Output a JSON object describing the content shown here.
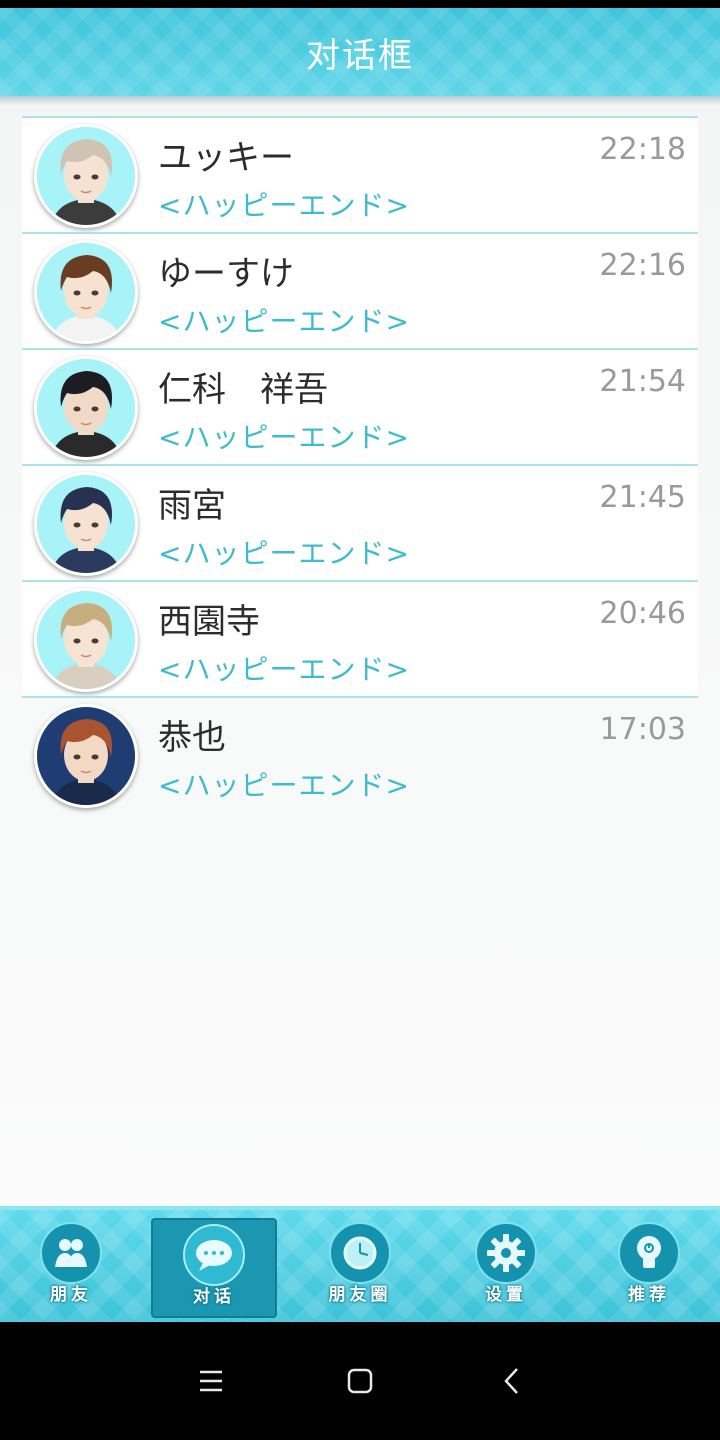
{
  "header": {
    "title": "对话框"
  },
  "chats": [
    {
      "name": "ユッキー",
      "time": "22:18",
      "message": "<ハッピーエンド>",
      "avatar": {
        "hair": "#cfc3b3",
        "skin": "#f6e2d3",
        "bg": "#a8f3f7",
        "shirt": "#3c3c3c"
      }
    },
    {
      "name": "ゆーすけ",
      "time": "22:16",
      "message": "<ハッピーエンド>",
      "avatar": {
        "hair": "#6a3c22",
        "skin": "#f7e1d0",
        "bg": "#a8f3f7",
        "shirt": "#f3f3f3"
      }
    },
    {
      "name": "仁科　祥吾",
      "time": "21:54",
      "message": "<ハッピーエンド>",
      "avatar": {
        "hair": "#1c1c22",
        "skin": "#f1d9c7",
        "bg": "#a8f3f7",
        "shirt": "#2a2a2a"
      }
    },
    {
      "name": "雨宮",
      "time": "21:45",
      "message": "<ハッピーエンド>",
      "avatar": {
        "hair": "#263250",
        "skin": "#f7e1d0",
        "bg": "#a8f3f7",
        "shirt": "#2d3a60"
      }
    },
    {
      "name": "西園寺",
      "time": "20:46",
      "message": "<ハッピーエンド>",
      "avatar": {
        "hair": "#c8ad80",
        "skin": "#f7e3d2",
        "bg": "#a8f3f7",
        "shirt": "#d8cfc0"
      }
    },
    {
      "name": "恭也",
      "time": "17:03",
      "message": "<ハッピーエンド>",
      "avatar": {
        "hair": "#a9542f",
        "skin": "#f3d8c4",
        "bg": "#1f3d72",
        "shirt": "#1a2a4a"
      }
    }
  ],
  "tabs": [
    {
      "label": "朋友",
      "icon": "friends-icon",
      "active": false
    },
    {
      "label": "对话",
      "icon": "chat-bubble-icon",
      "active": true
    },
    {
      "label": "朋友圈",
      "icon": "clock-icon",
      "active": false
    },
    {
      "label": "设置",
      "icon": "gear-icon",
      "active": false
    },
    {
      "label": "推荐",
      "icon": "lightbulb-icon",
      "active": false
    }
  ],
  "nav": {
    "buttons": [
      "menu-icon",
      "home-icon",
      "back-icon"
    ]
  }
}
